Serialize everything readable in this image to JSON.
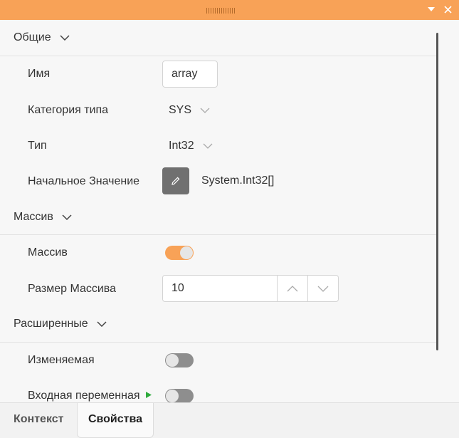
{
  "window": {
    "dropdown_icon": "triangle-down-icon",
    "close_icon": "close-icon",
    "accent": "#f8a257"
  },
  "sections": {
    "general": "Общие",
    "array": "Массив",
    "advanced": "Расширенные"
  },
  "general": {
    "name_label": "Имя",
    "name_value": "array",
    "type_category_label": "Категория типа",
    "type_category_value": "SYS",
    "type_label": "Тип",
    "type_value": "Int32",
    "initial_value_label": "Начальное Значение",
    "initial_value": "System.Int32[]"
  },
  "array": {
    "is_array_label": "Массив",
    "is_array": true,
    "size_label": "Размер Массива",
    "size_value": "10"
  },
  "advanced": {
    "mutable_label": "Изменяемая",
    "mutable": false,
    "input_variable_label": "Входная переменная",
    "input_variable": false
  },
  "tabs": {
    "context": "Контекст",
    "properties": "Свойства",
    "active": "properties"
  }
}
